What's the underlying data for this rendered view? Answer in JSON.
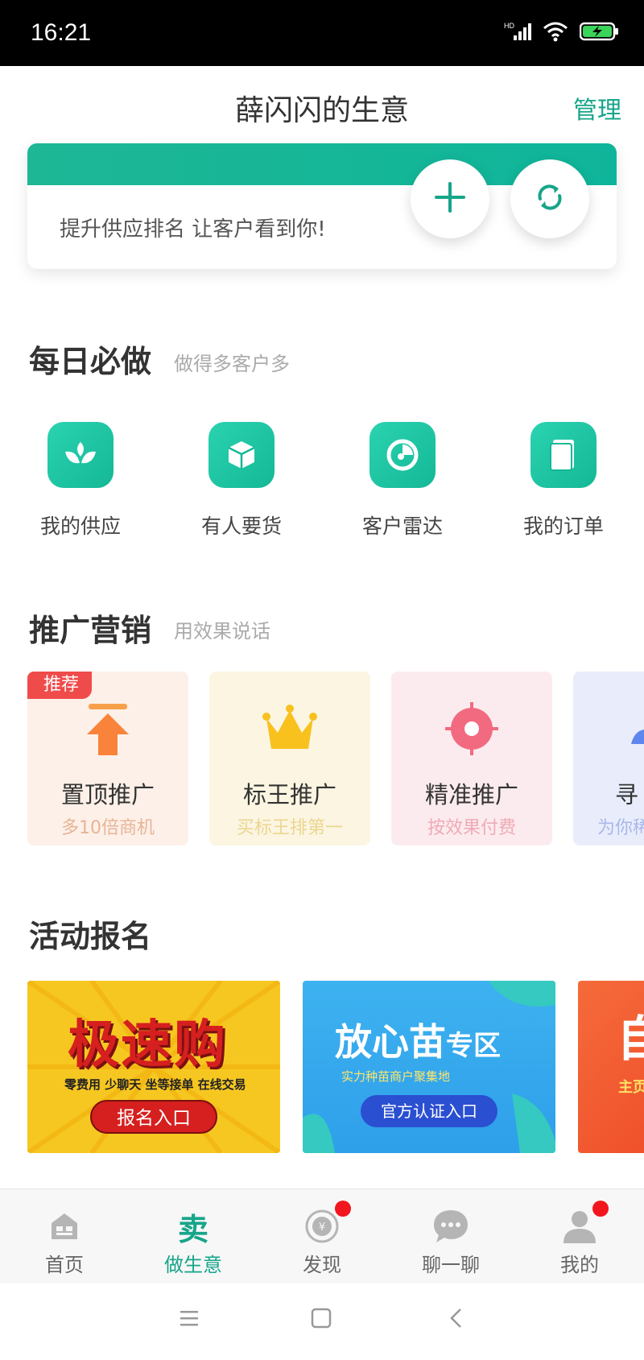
{
  "status_bar": {
    "time": "16:21",
    "network": "HD"
  },
  "header": {
    "title": "薛闪闪的生意",
    "manage_label": "管理"
  },
  "banner": {
    "slogan": "提升供应排名 让客户看到你!"
  },
  "daily": {
    "title": "每日必做",
    "subtitle": "做得多客户多",
    "items": [
      {
        "label": "我的供应",
        "icon": "leaf-icon"
      },
      {
        "label": "有人要货",
        "icon": "box-icon"
      },
      {
        "label": "客户雷达",
        "icon": "radar-icon"
      },
      {
        "label": "我的订单",
        "icon": "order-icon"
      }
    ]
  },
  "promo": {
    "title": "推广营销",
    "subtitle": "用效果说话",
    "items": [
      {
        "tag": "推荐",
        "title": "置顶推广",
        "sub": "多10倍商机"
      },
      {
        "title": "标王推广",
        "sub": "买标王排第一"
      },
      {
        "title": "精准推广",
        "sub": "按效果付费"
      },
      {
        "title": "寻",
        "sub": "为你",
        "ext": "稀"
      }
    ]
  },
  "events": {
    "title": "活动报名",
    "items": [
      {
        "big": "极速购",
        "small": "零费用 少聊天 坐等接单 在线交易",
        "button": "报名入口"
      },
      {
        "big": "放心苗",
        "big_suffix": "专区",
        "small": "实力种苗商户聚集地",
        "button": "官方认证入口"
      },
      {
        "big": "自",
        "small": "主页"
      }
    ]
  },
  "tabbar": {
    "items": [
      {
        "label": "首页",
        "icon": "home-icon"
      },
      {
        "label": "做生意",
        "icon": "sell-icon",
        "icon_text": "卖"
      },
      {
        "label": "发现",
        "icon": "discover-icon"
      },
      {
        "label": "聊一聊",
        "icon": "chat-icon"
      },
      {
        "label": "我的",
        "icon": "profile-icon"
      }
    ]
  },
  "colors": {
    "accent": "#17a58a",
    "badge": "#f2161e"
  }
}
